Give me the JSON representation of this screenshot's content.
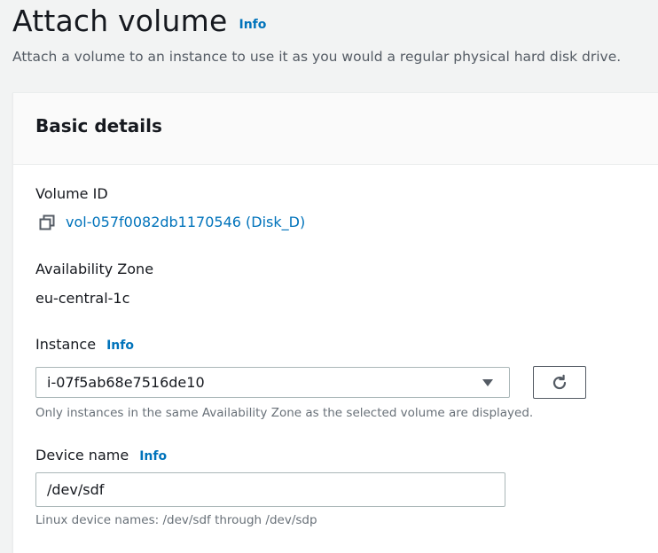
{
  "header": {
    "title": "Attach volume",
    "info_label": "Info",
    "description": "Attach a volume to an instance to use it as you would a regular physical hard disk drive."
  },
  "panel": {
    "title": "Basic details",
    "volume_id": {
      "label": "Volume ID",
      "value": "vol-057f0082db1170546 (Disk_D)",
      "icon": "copy-icon"
    },
    "availability_zone": {
      "label": "Availability Zone",
      "value": "eu-central-1c"
    },
    "instance": {
      "label": "Instance",
      "info_label": "Info",
      "selected": "i-07f5ab68e7516de10",
      "hint": "Only instances in the same Availability Zone as the selected volume are displayed.",
      "refresh_icon": "refresh-icon"
    },
    "device_name": {
      "label": "Device name",
      "info_label": "Info",
      "value": "/dev/sdf",
      "hint": "Linux device names: /dev/sdf through /dev/sdp"
    }
  },
  "colors": {
    "link": "#0073bb",
    "text": "#16191f",
    "secondary_text": "#545b64",
    "background": "#f2f3f3"
  }
}
